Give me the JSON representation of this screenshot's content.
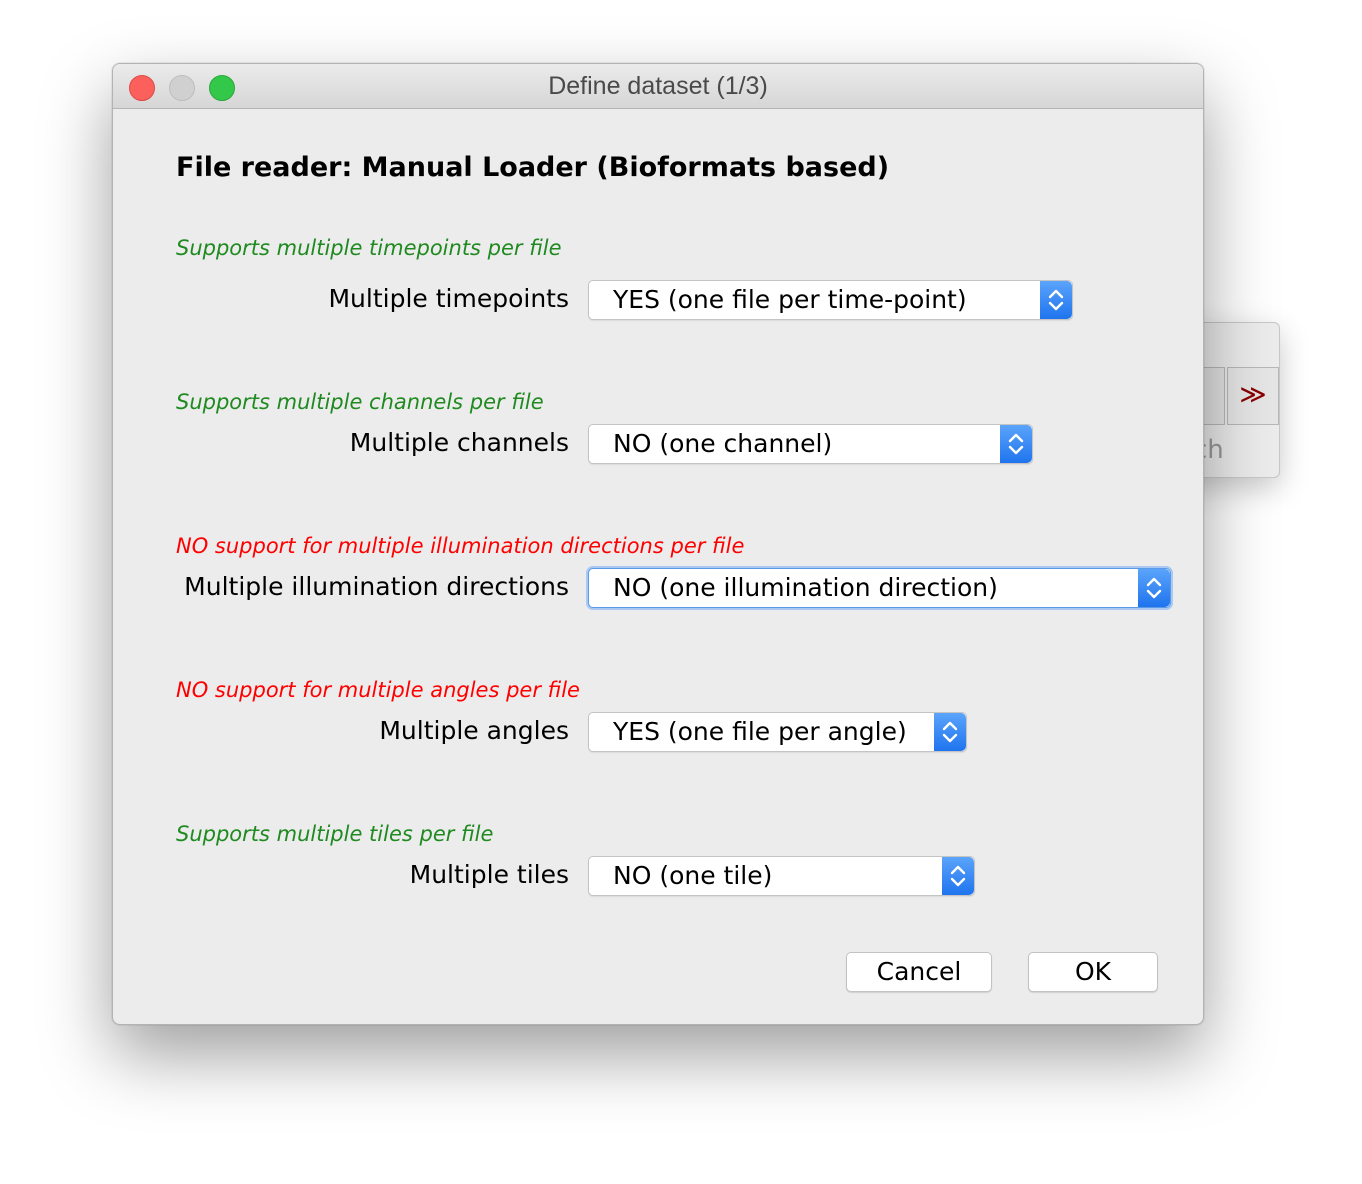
{
  "window": {
    "title": "Define dataset (1/3)",
    "heading": "File reader: Manual Loader (Bioformats based)"
  },
  "background_window": {
    "button_glyph": "≫",
    "partial_text": "ch"
  },
  "fields": {
    "timepoints": {
      "hint": "Supports multiple timepoints per file",
      "hint_color": "#1f8a1f",
      "label": "Multiple timepoints",
      "value": "YES (one file per time-point)"
    },
    "channels": {
      "hint": "Supports multiple channels per file",
      "hint_color": "#1f8a1f",
      "label": "Multiple channels",
      "value": "NO (one channel)"
    },
    "illumination": {
      "hint": "NO support for multiple illumination directions per file",
      "hint_color": "#ff0000",
      "label": "Multiple illumination directions",
      "value": "NO (one illumination direction)"
    },
    "angles": {
      "hint": "NO support for multiple angles per file",
      "hint_color": "#ff0000",
      "label": "Multiple angles",
      "value": "YES (one file per angle)"
    },
    "tiles": {
      "hint": "Supports multiple tiles per file",
      "hint_color": "#1f8a1f",
      "label": "Multiple tiles",
      "value": "NO (one tile)"
    }
  },
  "buttons": {
    "cancel": "Cancel",
    "ok": "OK"
  },
  "colors": {
    "accent_stepper": "#1f74ee",
    "focus_ring": "#5b9ae8"
  }
}
